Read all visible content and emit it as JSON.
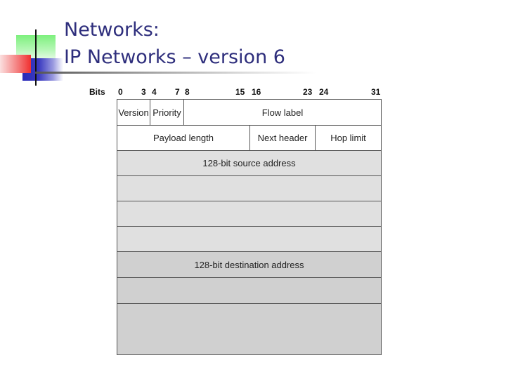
{
  "slide": {
    "title_line1": "Networks:",
    "title_line2": "IP Networks – version 6"
  },
  "diagram": {
    "bit_ruler": {
      "label": "Bits",
      "marks": [
        "0",
        "3",
        "4",
        "7",
        "8",
        "15",
        "16",
        "23",
        "24",
        "31"
      ]
    },
    "rows": [
      {
        "fields": [
          {
            "label": "Version",
            "bits": "0-3"
          },
          {
            "label": "Priority",
            "bits": "4-7"
          },
          {
            "label": "Flow label",
            "bits": "8-31"
          }
        ]
      },
      {
        "fields": [
          {
            "label": "Payload length",
            "bits": "0-15"
          },
          {
            "label": "Next header",
            "bits": "16-23"
          },
          {
            "label": "Hop limit",
            "bits": "24-31"
          }
        ]
      }
    ],
    "source_address": {
      "label": "128-bit source address",
      "word_rows": 4
    },
    "destination_address": {
      "label": "128-bit destination address",
      "word_rows": 4
    },
    "colors": {
      "title": "#2e2e7c",
      "header_fill": "#ffffff",
      "source_fill": "#e0e0e0",
      "destination_fill": "#d0d0d0",
      "border": "#555555"
    }
  }
}
